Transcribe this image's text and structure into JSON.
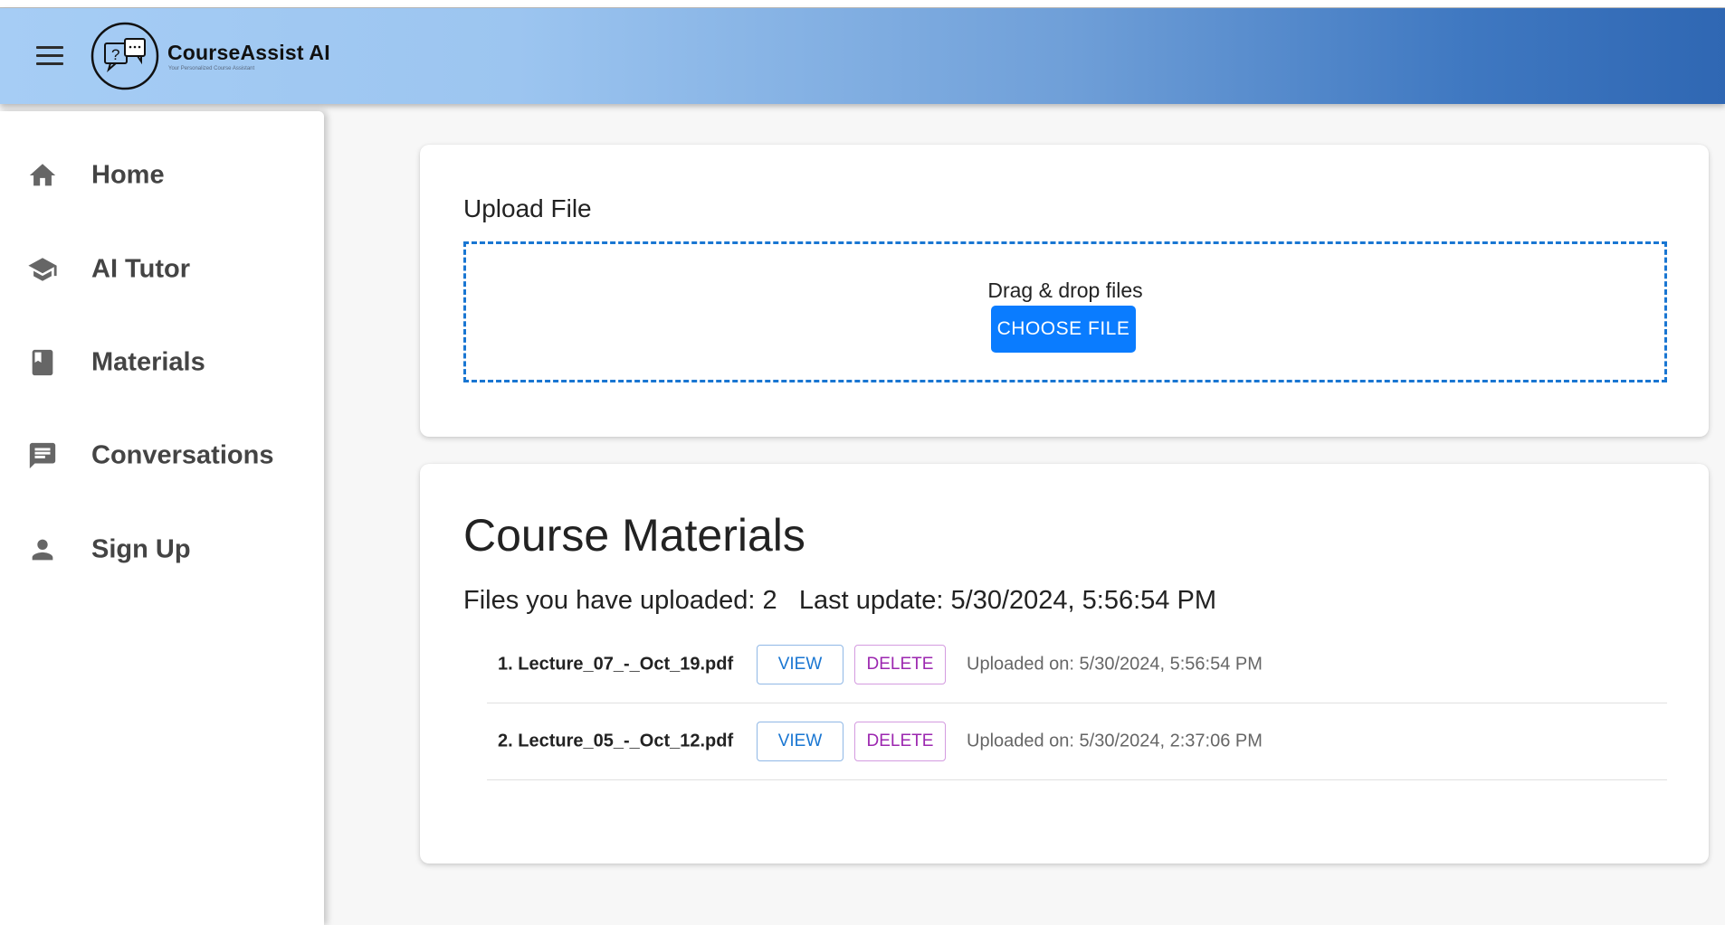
{
  "header": {
    "brand": "CourseAssist AI",
    "tagline": "Your Personalized Course Assistant",
    "menu_icon": "menu-icon",
    "logo_icon": "chat-question-logo"
  },
  "colors": {
    "primary": "#0a7cff",
    "view": "#1976d2",
    "delete": "#9c27b0",
    "appbar_start": "#a6cdf5",
    "appbar_end": "#2f67b3"
  },
  "sidebar": {
    "items": [
      {
        "label": "Home",
        "icon": "home-icon"
      },
      {
        "label": "AI Tutor",
        "icon": "school-icon"
      },
      {
        "label": "Materials",
        "icon": "book-icon"
      },
      {
        "label": "Conversations",
        "icon": "chat-icon"
      },
      {
        "label": "Sign Up",
        "icon": "person-icon"
      }
    ]
  },
  "upload": {
    "title": "Upload File",
    "drop_text": "Drag & drop files",
    "choose_button": "CHOOSE FILE"
  },
  "materials": {
    "title": "Course Materials",
    "files_label": "Files you have uploaded:",
    "files_count": "2",
    "update_label": "Last update:",
    "update_value": "5/30/2024, 5:56:54 PM",
    "files": [
      {
        "name": "1. Lecture_07_-_Oct_19.pdf",
        "view": "VIEW",
        "delete": "DELETE",
        "uploaded": "Uploaded on: 5/30/2024, 5:56:54 PM"
      },
      {
        "name": "2. Lecture_05_-_Oct_12.pdf",
        "view": "VIEW",
        "delete": "DELETE",
        "uploaded": "Uploaded on: 5/30/2024, 2:37:06 PM"
      }
    ]
  }
}
